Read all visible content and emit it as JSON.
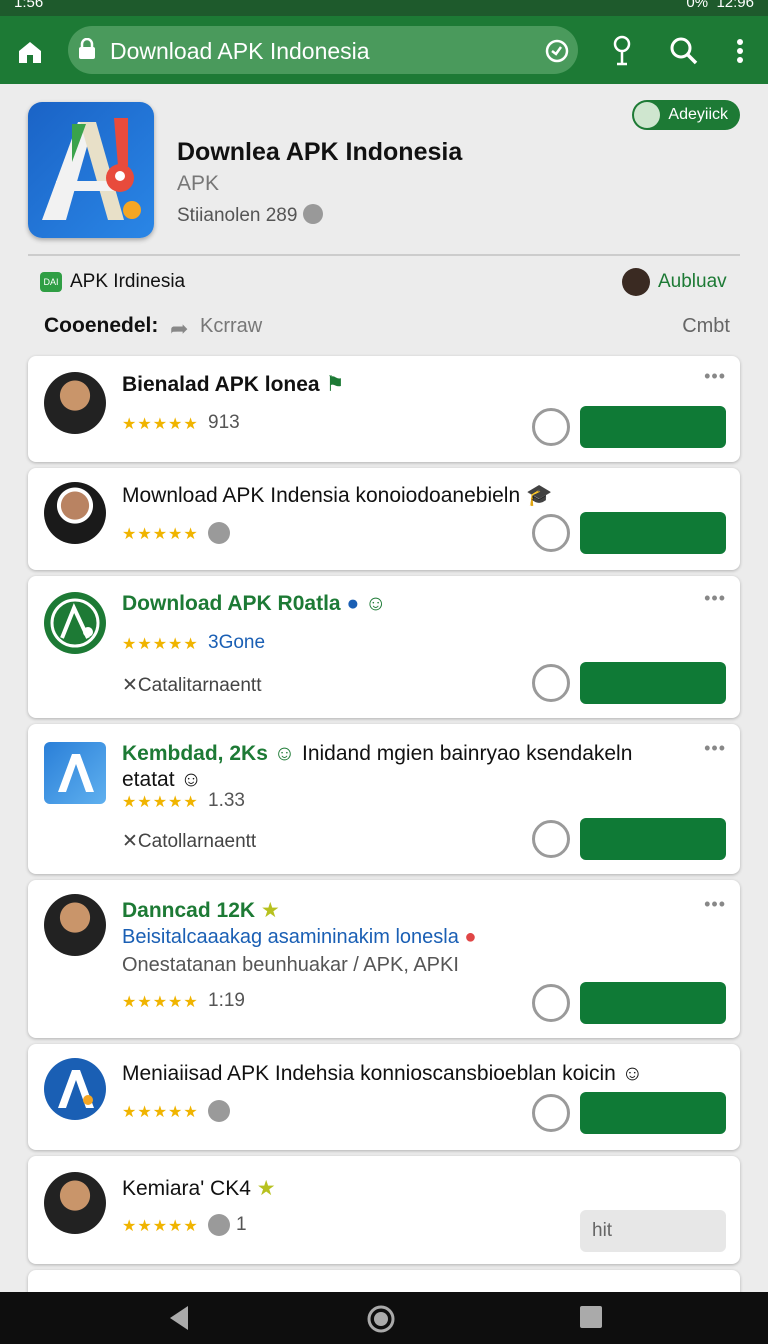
{
  "status": {
    "time_left": "1:56",
    "time_right": "12:96",
    "battery": "0%"
  },
  "browser": {
    "url": "Download APK Indonesia"
  },
  "app": {
    "title": "Downlea APK Indonesia",
    "subtitle": "APK",
    "meta": "Stiianolen 289",
    "chip": "Adeyiick"
  },
  "section": {
    "label": "APK Irdinesia",
    "right_label": "Aubluav",
    "icon_text": "DAI"
  },
  "filter": {
    "label": "Cooenedel:",
    "value": "Kcrraw",
    "right": "Cmbt"
  },
  "cards": [
    {
      "title": "Bienalad APK lonea",
      "stars": "★★★★★",
      "count": "913"
    },
    {
      "title": "Mownload APK Indensia konoiodoanebieln",
      "stars": "★★★★★"
    },
    {
      "title": "Download APK R0atla",
      "stars": "★★★★★",
      "count": "3Gone",
      "rich": "✕Catalitarnaentt"
    },
    {
      "title": "Kembdad, 2Ks",
      "title2": "Inidand mgien bainryao ksendakeln",
      "title3": "etatat",
      "stars": "★★★★★",
      "count": "1.33",
      "rich": "✕Catollarnaentt"
    },
    {
      "title": "Danncad 12K",
      "line2": "Beisitalcaaakag asamininakim lonesla",
      "line3": "Onestatanan beunhuakar / APK, APKI",
      "stars": "★★★★★",
      "count": "1:19"
    },
    {
      "title": "Meniaiisad APK Indehsia konnioscansbioeblan koicin",
      "stars": "★★★★★"
    },
    {
      "title": "Kemiara' CK4",
      "stars": "★★★★★",
      "count": "1",
      "button": "hit"
    }
  ],
  "colors": {
    "primary": "#1d7a35",
    "statusbar": "#1e5a2c",
    "button": "#0f7a36",
    "star": "#f0b400"
  }
}
